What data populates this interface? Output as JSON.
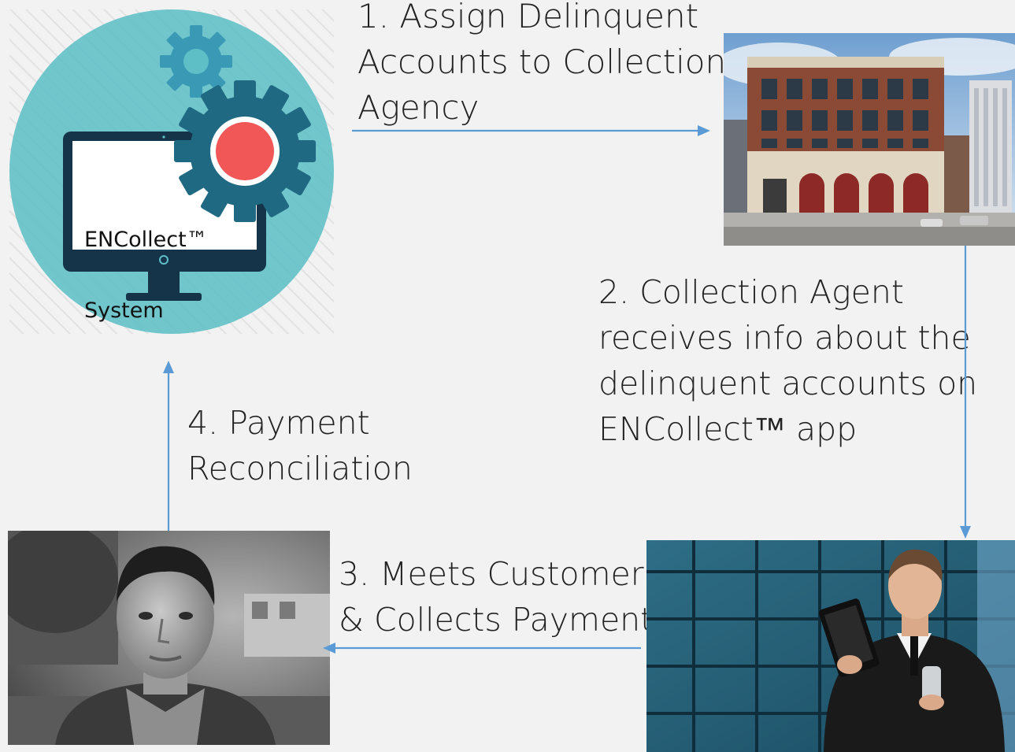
{
  "system": {
    "label_line1": "ENCollect™",
    "label_line2": "System",
    "colors": {
      "circle": "#5ec0c6",
      "gear": "#1f6a82",
      "gear_light": "#3a9ab5",
      "screen_frame": "#15344a",
      "red_dot": "#f25757"
    },
    "icons": [
      "gear-icon",
      "monitor-icon"
    ]
  },
  "steps": [
    {
      "lines": [
        "1. Assign Delinquent",
        "Accounts to Collection",
        "Agency"
      ]
    },
    {
      "lines": [
        "2. Collection Agent",
        "receives info about the",
        "delinquent accounts on",
        "ENCollect™ app"
      ]
    },
    {
      "lines": [
        "3. Meets Customer",
        "& Collects Payment"
      ]
    },
    {
      "lines": [
        "4. Payment",
        "Reconciliation"
      ]
    }
  ],
  "arrow_color": "#5b9bd5",
  "photos": {
    "building": "building-photo",
    "customer": "customer-photo",
    "agent": "agent-with-tablet-photo"
  }
}
